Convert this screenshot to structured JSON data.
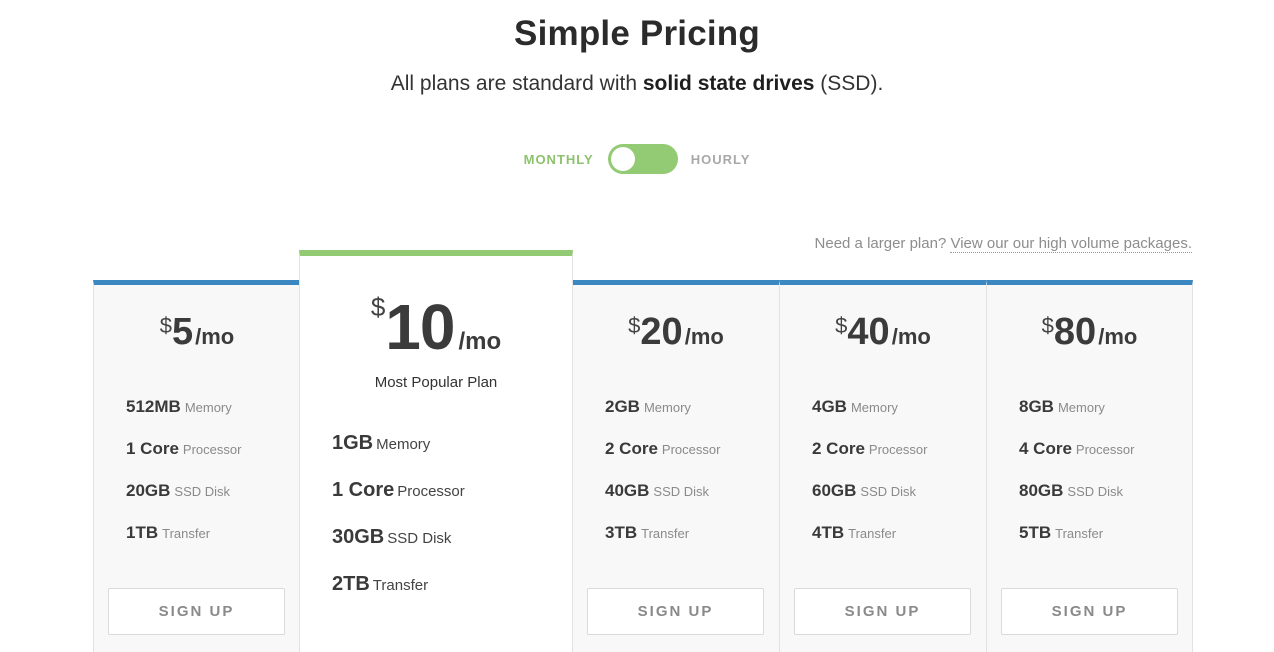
{
  "header": {
    "title": "Simple Pricing",
    "subtitle_pre": "All plans are standard with ",
    "subtitle_bold": "solid state drives",
    "subtitle_post": " (SSD)."
  },
  "billing_toggle": {
    "left_label": "MONTHLY",
    "right_label": "HOURLY",
    "selected": "MONTHLY",
    "accent_color": "#93ca74"
  },
  "larger_plan": {
    "text": "Need a larger plan? ",
    "link": "View our our high volume packages."
  },
  "colors": {
    "card_top_border": "#3a87c2",
    "featured_top_border": "#93ca74"
  },
  "plans": [
    {
      "currency": "$",
      "amount": "5",
      "period": "/mo",
      "specs": [
        {
          "value": "512MB",
          "unit": "Memory"
        },
        {
          "value": "1 Core",
          "unit": "Processor"
        },
        {
          "value": "20GB",
          "unit": "SSD Disk"
        },
        {
          "value": "1TB",
          "unit": "Transfer"
        }
      ],
      "button": "SIGN UP"
    },
    {
      "currency": "$",
      "amount": "10",
      "period": "/mo",
      "badge": "Most Popular Plan",
      "specs": [
        {
          "value": "1GB",
          "unit": "Memory"
        },
        {
          "value": "1 Core",
          "unit": "Processor"
        },
        {
          "value": "30GB",
          "unit": "SSD Disk"
        },
        {
          "value": "2TB",
          "unit": "Transfer"
        }
      ]
    },
    {
      "currency": "$",
      "amount": "20",
      "period": "/mo",
      "specs": [
        {
          "value": "2GB",
          "unit": "Memory"
        },
        {
          "value": "2 Core",
          "unit": "Processor"
        },
        {
          "value": "40GB",
          "unit": "SSD Disk"
        },
        {
          "value": "3TB",
          "unit": "Transfer"
        }
      ],
      "button": "SIGN UP"
    },
    {
      "currency": "$",
      "amount": "40",
      "period": "/mo",
      "specs": [
        {
          "value": "4GB",
          "unit": "Memory"
        },
        {
          "value": "2 Core",
          "unit": "Processor"
        },
        {
          "value": "60GB",
          "unit": "SSD Disk"
        },
        {
          "value": "4TB",
          "unit": "Transfer"
        }
      ],
      "button": "SIGN UP"
    },
    {
      "currency": "$",
      "amount": "80",
      "period": "/mo",
      "specs": [
        {
          "value": "8GB",
          "unit": "Memory"
        },
        {
          "value": "4 Core",
          "unit": "Processor"
        },
        {
          "value": "80GB",
          "unit": "SSD Disk"
        },
        {
          "value": "5TB",
          "unit": "Transfer"
        }
      ],
      "button": "SIGN UP"
    }
  ]
}
